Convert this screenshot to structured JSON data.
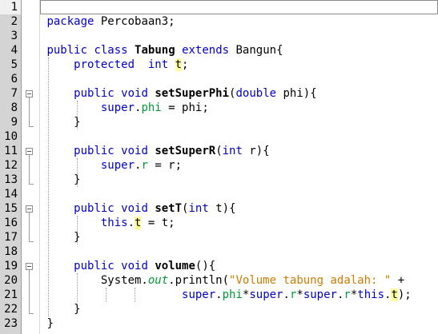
{
  "editor": {
    "line_numbers": [
      "1",
      "2",
      "3",
      "4",
      "5",
      "6",
      "7",
      "8",
      "9",
      "10",
      "11",
      "12",
      "13",
      "14",
      "15",
      "16",
      "17",
      "18",
      "19",
      "20",
      "21",
      "22",
      "23"
    ],
    "code": {
      "l2": {
        "kw": "package",
        "rest": " Percobaan3;"
      },
      "l4": {
        "public": "public",
        "class": "class",
        "name": "Tabung",
        "extends": "extends",
        "parent": " Bangun{"
      },
      "l5": {
        "protected": "protected",
        "int": "int",
        "var": "t",
        "semi": ";"
      },
      "l7": {
        "public": "public",
        "void": "void",
        "name": "setSuperPhi",
        "open": "(",
        "type": "double",
        "param": " phi){"
      },
      "l8": {
        "super": "super",
        "dot": ".",
        "field": "phi",
        "rest": " = phi;"
      },
      "l9": {
        "brace": "}"
      },
      "l11": {
        "public": "public",
        "void": "void",
        "name": "setSuperR",
        "open": "(",
        "type": "int",
        "param": " r){"
      },
      "l12": {
        "super": "super",
        "dot": ".",
        "field": "r",
        "rest": " = r;"
      },
      "l13": {
        "brace": "}"
      },
      "l15": {
        "public": "public",
        "void": "void",
        "name": "setT",
        "open": "(",
        "type": "int",
        "param": " t){"
      },
      "l16": {
        "this": "this",
        "dot": ".",
        "var": "t",
        "rest": " = t;"
      },
      "l17": {
        "brace": "}"
      },
      "l19": {
        "public": "public",
        "void": "void",
        "name": "volume",
        "rest": "(){"
      },
      "l20": {
        "sys": "System.",
        "out": "out",
        "println": ".println(",
        "str": "\"Volume tabung adalah: \"",
        "plus": " +"
      },
      "l21": {
        "s1": "super",
        "d1": ".",
        "f1": "phi",
        "m1": "*",
        "s2": "super",
        "d2": ".",
        "f2": "r",
        "m2": "*",
        "s3": "super",
        "d3": ".",
        "f3": "r",
        "m3": "*",
        "t": "this",
        "d4": ".",
        "v": "t",
        "end": ");"
      },
      "l22": {
        "brace": "}"
      },
      "l23": {
        "brace": "}"
      }
    }
  }
}
